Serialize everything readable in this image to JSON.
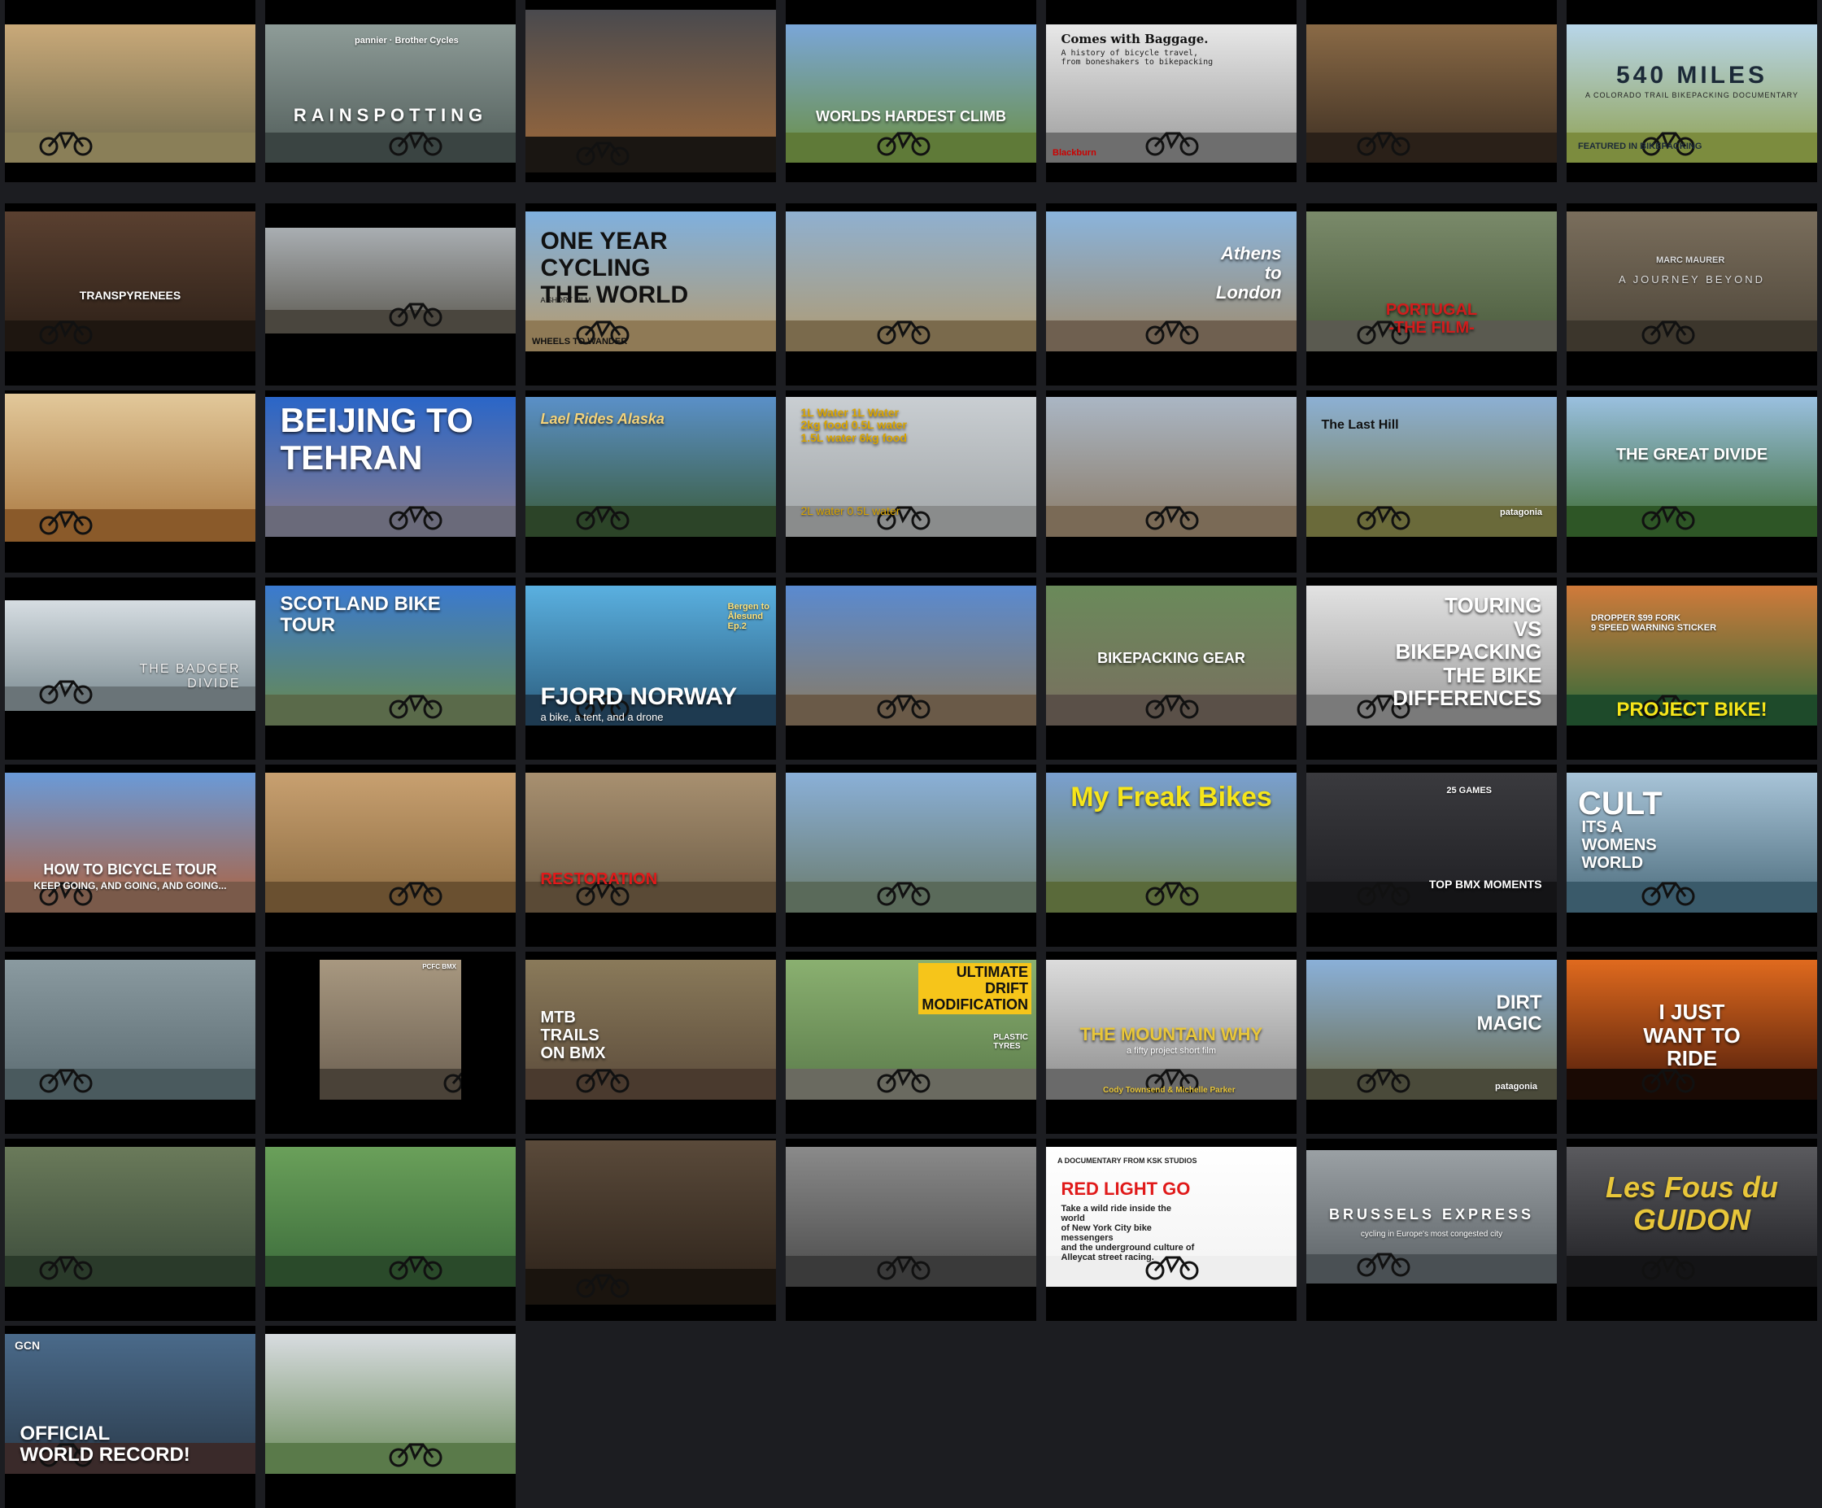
{
  "videos": [
    {
      "title": "",
      "subtitle": "",
      "tag": "",
      "bg": [
        "#c9a979",
        "#6f6a4d"
      ],
      "ground": "#8a7f58"
    },
    {
      "title": "RAINSPOTTING",
      "subtitle": "",
      "tag": "pannier · Brother Cycles",
      "bg": [
        "#8e9c98",
        "#4f5b58"
      ],
      "ground": "#3a4442"
    },
    {
      "title": "",
      "subtitle": "",
      "tag": "",
      "bg": [
        "#4a4a4e",
        "#a06a3a"
      ],
      "ground": "#1a1612"
    },
    {
      "title": "WORLDS HARDEST CLIMB",
      "subtitle": "",
      "tag": "",
      "bg": [
        "#7aa6d8",
        "#6b8f3f"
      ],
      "ground": "#5f7a38"
    },
    {
      "title": "Comes with Baggage.",
      "subtitle": "A history of bicycle travel,\nfrom boneshakers to bikepacking",
      "tag": "Blackburn",
      "bg": [
        "#e8e8e8",
        "#9a9a9a"
      ],
      "ground": "#6e6e6e"
    },
    {
      "title": "",
      "subtitle": "",
      "tag": "",
      "bg": [
        "#8a6a46",
        "#3c2e22"
      ],
      "ground": "#2a2018"
    },
    {
      "title": "540 MILES",
      "subtitle": "A COLORADO TRAIL BIKEPACKING DOCUMENTARY",
      "tag": "FEATURED IN BIKEPACKING",
      "bg": [
        "#b8d6ea",
        "#8fa04e"
      ],
      "ground": "#7c8c3e"
    },
    {
      "title": "TRANSPYRENEES",
      "subtitle": "",
      "tag": "",
      "bg": [
        "#5a4030",
        "#2a1e16"
      ],
      "ground": "#1e1610"
    },
    {
      "title": "",
      "subtitle": "",
      "tag": "",
      "bg": [
        "#a9aeb2",
        "#5d5a52"
      ],
      "ground": "#4a463e"
    },
    {
      "title": "ONE YEAR\nCYCLING\nTHE WORLD",
      "subtitle": "A SHORT FILM",
      "tag": "WHEELS TO WANDER",
      "bg": [
        "#7fb0de",
        "#b89a6a"
      ],
      "ground": "#8f7a56"
    },
    {
      "title": "",
      "subtitle": "",
      "tag": "",
      "bg": [
        "#8fb0d0",
        "#b09a70"
      ],
      "ground": "#7a6a4c"
    },
    {
      "title": "Athens\nto\nLondon",
      "subtitle": "",
      "tag": "",
      "bg": [
        "#8ab4dc",
        "#a08a6a"
      ],
      "ground": "#6f6050"
    },
    {
      "title": "PORTUGAL\n-THE FILM-",
      "subtitle": "",
      "tag": "",
      "bg": [
        "#7a8a6a",
        "#4a5a3c"
      ],
      "ground": "#5a5a50"
    },
    {
      "title": "",
      "subtitle": "A JOURNEY BEYOND",
      "tag": "MARC MAURER",
      "bg": [
        "#7a6e5c",
        "#4c4438"
      ],
      "ground": "#3c362c"
    },
    {
      "title": "",
      "subtitle": "",
      "tag": "",
      "bg": [
        "#e2c89a",
        "#a8763e"
      ],
      "ground": "#8a5a2a"
    },
    {
      "title": "BEIJING TO\nTEHRAN",
      "subtitle": "",
      "tag": "",
      "bg": [
        "#2a66c8",
        "#8a7a8a"
      ],
      "ground": "#6a6a7a"
    },
    {
      "title": "Lael Rides Alaska",
      "subtitle": "",
      "tag": "",
      "bg": [
        "#5a90c8",
        "#3a5a36"
      ],
      "ground": "#2c4428"
    },
    {
      "title": "1L Water   1L Water\n2kg food   0.5L water\n1.5L water   6kg food",
      "subtitle": "2L water   0.5L water",
      "tag": "",
      "bg": [
        "#c9ced2",
        "#a0a4a6"
      ],
      "ground": "#8a8c8c"
    },
    {
      "title": "",
      "subtitle": "",
      "tag": "",
      "bg": [
        "#aab6c4",
        "#8a7a66"
      ],
      "ground": "#7a6a56"
    },
    {
      "title": "The Last Hill",
      "subtitle": "",
      "tag": "patagonia",
      "bg": [
        "#8cb0d4",
        "#7a7a44"
      ],
      "ground": "#6a6a3a"
    },
    {
      "title": "THE GREAT DIVIDE",
      "subtitle": "",
      "tag": "",
      "bg": [
        "#9ac0e0",
        "#3c6a30"
      ],
      "ground": "#2e5626"
    },
    {
      "title": "",
      "subtitle": "THE BADGER\nDIVIDE",
      "tag": "",
      "bg": [
        "#d6dde2",
        "#7a8a90"
      ],
      "ground": "#6a7478"
    },
    {
      "title": "SCOTLAND BIKE TOUR",
      "subtitle": "",
      "tag": "",
      "bg": [
        "#3a7ad0",
        "#6a8a4a"
      ],
      "ground": "#5a6a4a"
    },
    {
      "title": "FJORD NORWAY",
      "subtitle": "a bike, a tent, and a drone",
      "tag": "Bergen to\nÅlesund\nEp.2",
      "bg": [
        "#5ab0e0",
        "#2a5a7a"
      ],
      "ground": "#1e3a50"
    },
    {
      "title": "",
      "subtitle": "",
      "tag": "",
      "bg": [
        "#5a8ad0",
        "#8a7a60"
      ],
      "ground": "#6a5a48"
    },
    {
      "title": "BIKEPACKING GEAR",
      "subtitle": "",
      "tag": "",
      "bg": [
        "#6a8a5a",
        "#7a6e60"
      ],
      "ground": "#5a5048"
    },
    {
      "title": "TOURING\nVS\nBIKEPACKING\nTHE BIKE\nDIFFERENCES",
      "subtitle": "",
      "tag": "",
      "bg": [
        "#e2e2e2",
        "#9a9a9a"
      ],
      "ground": "#7a7a7a"
    },
    {
      "title": "PROJECT BIKE!",
      "subtitle": "",
      "tag": "DROPPER   $99 FORK\n9 SPEED   WARNING STICKER",
      "bg": [
        "#d07a3a",
        "#2a6a3a"
      ],
      "ground": "#1e4a2a"
    },
    {
      "title": "HOW TO BICYCLE TOUR",
      "subtitle": "KEEP GOING, AND GOING, AND GOING...",
      "tag": "",
      "bg": [
        "#6a9ad8",
        "#b0603a"
      ],
      "ground": "#7a5a4a"
    },
    {
      "title": "",
      "subtitle": "",
      "tag": "",
      "bg": [
        "#c8a070",
        "#8a6a40"
      ],
      "ground": "#6a5030"
    },
    {
      "title": "RESTORATION",
      "subtitle": "",
      "tag": "",
      "bg": [
        "#a89070",
        "#6a5a44"
      ],
      "ground": "#5a4a36"
    },
    {
      "title": "",
      "subtitle": "",
      "tag": "",
      "bg": [
        "#8ab0d8",
        "#6a7a6a"
      ],
      "ground": "#5a6a5a"
    },
    {
      "title": "My Freak Bikes",
      "subtitle": "",
      "tag": "",
      "bg": [
        "#7aa0d0",
        "#6a7a4a"
      ],
      "ground": "#5a6a3a"
    },
    {
      "title": "TOP BMX MOMENTS",
      "subtitle": "",
      "tag": "25 GAMES",
      "bg": [
        "#3a3a3e",
        "#1e1e22"
      ],
      "ground": "#141416"
    },
    {
      "title": "ITS A\nWOMENS\nWORLD",
      "subtitle": "",
      "tag": "CULT",
      "bg": [
        "#a8c4d8",
        "#4a6a7a"
      ],
      "ground": "#3a5a6a"
    },
    {
      "title": "",
      "subtitle": "",
      "tag": "",
      "bg": [
        "#8a9aa0",
        "#5a6a70"
      ],
      "ground": "#4a5a5e"
    },
    {
      "title": "",
      "subtitle": "",
      "tag": "PCFC BMX",
      "bg": [
        "#a89880",
        "#6a5e50"
      ],
      "ground": "#4a4238"
    },
    {
      "title": "MTB\nTRAILS\nON BMX",
      "subtitle": "",
      "tag": "",
      "bg": [
        "#8a7a5a",
        "#5a4a3a"
      ],
      "ground": "#4a3a2e"
    },
    {
      "title": "ULTIMATE\nDRIFT\nMODIFICATION",
      "subtitle": "",
      "tag": "PLASTIC\nTYRES",
      "bg": [
        "#8ab070",
        "#5a7a4a"
      ],
      "ground": "#6a6a60"
    },
    {
      "title": "THE MOUNTAIN WHY",
      "subtitle": "a fifty project short film",
      "tag": "Cody Townsend & Michelle Parker",
      "bg": [
        "#dcdcdc",
        "#8a8a8a"
      ],
      "ground": "#6a6a6a"
    },
    {
      "title": "DIRT\nMAGIC",
      "subtitle": "",
      "tag": "patagonia",
      "bg": [
        "#8ab0d8",
        "#6a6a4a"
      ],
      "ground": "#4a4a3a"
    },
    {
      "title": "I JUST\nWANT TO\nRIDE",
      "subtitle": "",
      "tag": "",
      "bg": [
        "#e06a1e",
        "#4a1a0a"
      ],
      "ground": "#1a0a04"
    },
    {
      "title": "",
      "subtitle": "",
      "tag": "",
      "bg": [
        "#6a7a5a",
        "#3a4a3a"
      ],
      "ground": "#2a3a2a"
    },
    {
      "title": "",
      "subtitle": "",
      "tag": "",
      "bg": [
        "#6aa05a",
        "#3a6a3a"
      ],
      "ground": "#2a4a2a"
    },
    {
      "title": "",
      "subtitle": "",
      "tag": "",
      "bg": [
        "#5a4a3a",
        "#2a2018"
      ],
      "ground": "#1a140e"
    },
    {
      "title": "",
      "subtitle": "",
      "tag": "",
      "bg": [
        "#8a8a8a",
        "#4a4a4a"
      ],
      "ground": "#3a3a3a"
    },
    {
      "title": "RED LIGHT GO",
      "subtitle": "Take a wild ride inside the world\nof New York City bike messengers\nand the underground culture of\nAlleycat street racing.",
      "tag": "A DOCUMENTARY FROM KSK STUDIOS",
      "bg": [
        "#ffffff",
        "#f2f2f2"
      ],
      "ground": "#eeeeee"
    },
    {
      "title": "BRUSSELS EXPRESS",
      "subtitle": "cycling in Europe's most congested city",
      "tag": "",
      "bg": [
        "#9aa0a4",
        "#5a6064"
      ],
      "ground": "#4a5054"
    },
    {
      "title": "Les Fous du\nGUIDON",
      "subtitle": "",
      "tag": "",
      "bg": [
        "#5a5a5e",
        "#1e1e22"
      ],
      "ground": "#141416"
    },
    {
      "title": "OFFICIAL\nWORLD RECORD!",
      "subtitle": "",
      "tag": "GCN",
      "bg": [
        "#4a6a8a",
        "#2a3a4a"
      ],
      "ground": "#3a2a2a"
    },
    {
      "title": "",
      "subtitle": "",
      "tag": "",
      "bg": [
        "#d8dce0",
        "#6a8a5a"
      ],
      "ground": "#5a7a4a"
    }
  ]
}
